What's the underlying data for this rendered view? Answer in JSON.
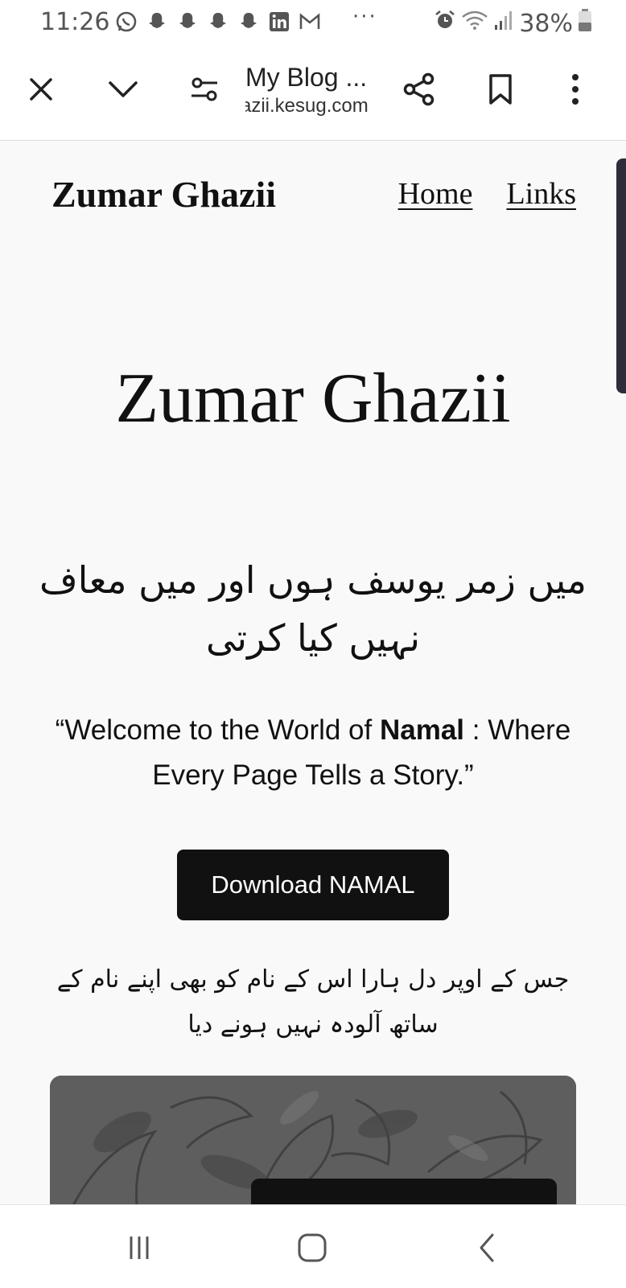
{
  "status_bar": {
    "time": "11:26",
    "battery": "38%",
    "more": "···",
    "notification_icons": [
      "whatsapp-icon",
      "snapchat-icon",
      "snapchat-icon",
      "snapchat-icon",
      "snapchat-icon",
      "linkedin-icon",
      "gmail-icon"
    ],
    "system_icons": [
      "alarm-icon",
      "wifi-icon",
      "signal-icon",
      "battery-icon"
    ]
  },
  "toolbar": {
    "title": "My Blog ...",
    "url": "azii.kesug.com",
    "icons": [
      "close-icon",
      "chevron-down-icon",
      "tune-icon",
      "share-icon",
      "bookmark-icon",
      "more-vert-icon"
    ]
  },
  "site": {
    "title": "Zumar Ghazii",
    "nav": [
      "Home",
      "Links"
    ]
  },
  "hero": {
    "title": "Zumar Ghazii",
    "urdu_heading": "میں زمر یوسف ہوں اور میں معاف نہیں کیا کرتی",
    "quote_start": "“Welcome to the World of ",
    "quote_bold": "Namal",
    "quote_end": " : Where Every Page Tells a Story.”",
    "download_label": "Download NAMAL",
    "urdu_paragraph": "جس کے اوپر دل ہارا اس کے نام کو بھی اپنے نام کے ساتھ آلودہ نہیں ہونے دیا"
  },
  "colors": {
    "page_bg": "#f9f9f9",
    "button_bg": "#111111",
    "scroll_thumb": "#2d2b3c"
  },
  "navbar": {
    "icons": [
      "recent-apps-icon",
      "home-icon",
      "back-icon"
    ]
  }
}
